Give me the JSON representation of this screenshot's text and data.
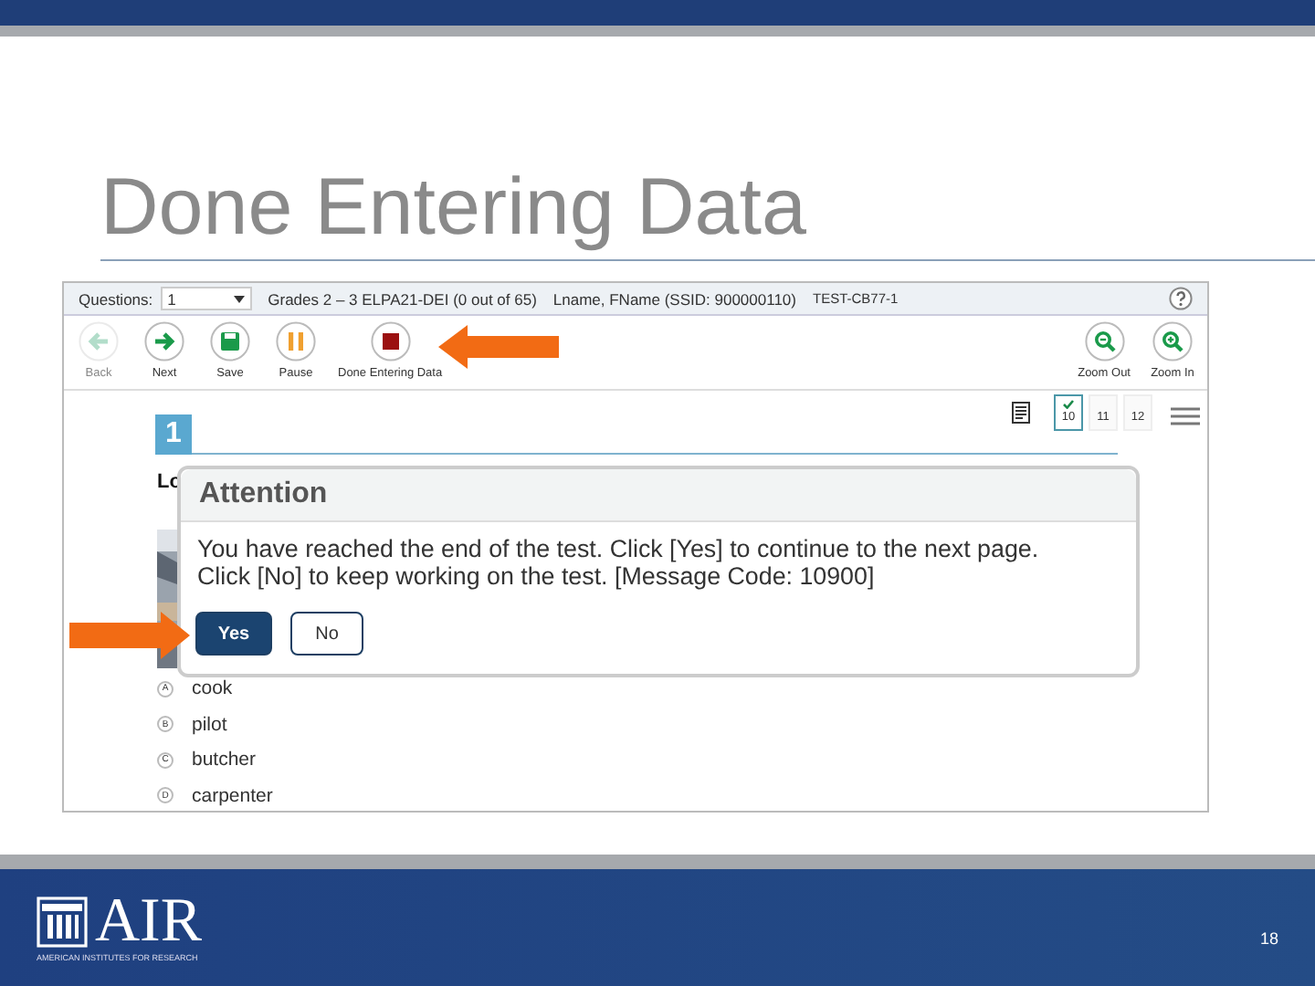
{
  "slide": {
    "title": "Done Entering Data",
    "page_number": "18"
  },
  "logo": {
    "name": "AIR",
    "tagline": "AMERICAN INSTITUTES FOR RESEARCH"
  },
  "app": {
    "header": {
      "questions_label": "Questions:",
      "question_value": "1",
      "test_title": "Grades 2 – 3 ELPA21-DEI (0 out of 65)",
      "student": "Lname, FName (SSID: 900000110)",
      "session": "TEST-CB77-1"
    },
    "toolbar_left": [
      {
        "kind": "back",
        "label": "Back",
        "disabled": true
      },
      {
        "kind": "next",
        "label": "Next",
        "disabled": false
      },
      {
        "kind": "save",
        "label": "Save",
        "disabled": false
      },
      {
        "kind": "pause",
        "label": "Pause",
        "disabled": false
      },
      {
        "kind": "stop",
        "label": "Done Entering Data",
        "disabled": false
      }
    ],
    "toolbar_right": [
      {
        "kind": "zoom_out",
        "label": "Zoom Out",
        "disabled": false
      },
      {
        "kind": "zoom_in",
        "label": "Zoom In",
        "disabled": false
      }
    ],
    "page_tabs": [
      {
        "label": "10",
        "selected": true,
        "checked": true
      },
      {
        "label": "11",
        "selected": false,
        "checked": false
      },
      {
        "label": "12",
        "selected": false,
        "checked": false
      }
    ],
    "question_number": "1",
    "question_text": "Lo",
    "options": [
      {
        "letter": "A",
        "text": "cook"
      },
      {
        "letter": "B",
        "text": "pilot"
      },
      {
        "letter": "C",
        "text": "butcher"
      },
      {
        "letter": "D",
        "text": "carpenter"
      }
    ],
    "dialog": {
      "title": "Attention",
      "message": "You have reached the end of the test. Click [Yes] to continue to the next page. Click [No] to keep working on the test. [Message Code: 10900]",
      "buttons": [
        {
          "label": "Yes",
          "primary": true
        },
        {
          "label": "No",
          "primary": false
        }
      ]
    }
  }
}
